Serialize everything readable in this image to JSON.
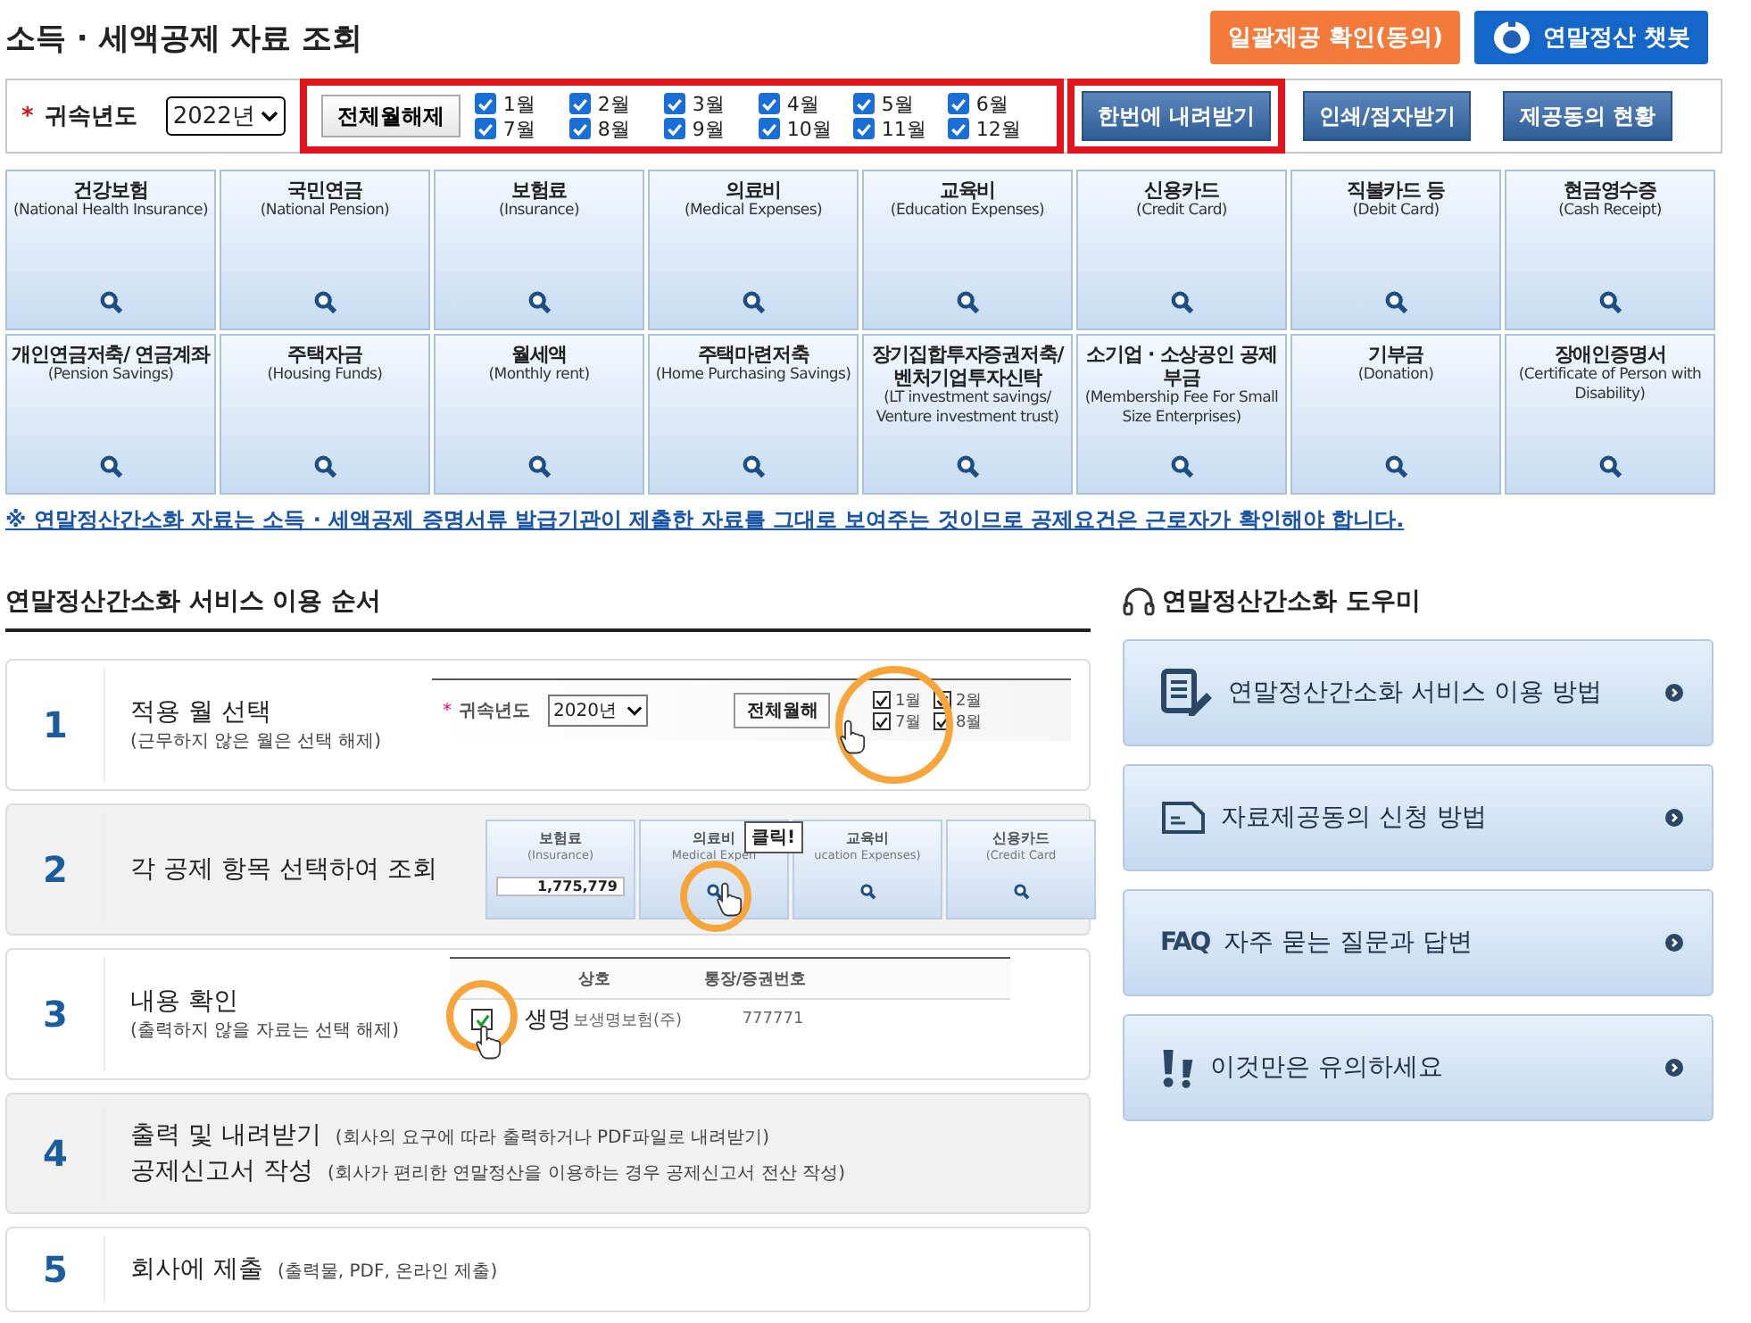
{
  "page_title": "소득 · 세액공제 자료 조회",
  "header_buttons": [
    {
      "kind": "consent",
      "label": "일괄제공 확인(동의)"
    },
    {
      "kind": "chatbot",
      "label": "연말정산 챗봇"
    }
  ],
  "filter": {
    "required_mark": "*",
    "year_label": "귀속년도",
    "year": "2022년",
    "highlighted": true,
    "clear_button": "전체월해제",
    "months": [
      {
        "label": "1월",
        "checked": true
      },
      {
        "label": "2월",
        "checked": true
      },
      {
        "label": "3월",
        "checked": true
      },
      {
        "label": "4월",
        "checked": true
      },
      {
        "label": "5월",
        "checked": true
      },
      {
        "label": "6월",
        "checked": true
      },
      {
        "label": "7월",
        "checked": true
      },
      {
        "label": "8월",
        "checked": true
      },
      {
        "label": "9월",
        "checked": true
      },
      {
        "label": "10월",
        "checked": true
      },
      {
        "label": "11월",
        "checked": true
      },
      {
        "label": "12월",
        "checked": true
      }
    ],
    "buttons": [
      {
        "label": "한번에 내려받기",
        "highlighted": true
      },
      {
        "label": "인쇄/점자받기",
        "highlighted": false
      },
      {
        "label": "제공동의 현황",
        "highlighted": false
      }
    ]
  },
  "categories": [
    {
      "title": "건강보험",
      "subtitle": "(National Health Insurance)"
    },
    {
      "title": "국민연금",
      "subtitle": "(National Pension)"
    },
    {
      "title": "보험료",
      "subtitle": "(Insurance)"
    },
    {
      "title": "의료비",
      "subtitle": "(Medical Expenses)"
    },
    {
      "title": "교육비",
      "subtitle": "(Education Expenses)"
    },
    {
      "title": "신용카드",
      "subtitle": "(Credit Card)"
    },
    {
      "title": "직불카드 등",
      "subtitle": "(Debit Card)"
    },
    {
      "title": "현금영수증",
      "subtitle": "(Cash Receipt)"
    },
    {
      "title": "개인연금저축/ 연금계좌",
      "subtitle": "(Pension Savings)"
    },
    {
      "title": "주택자금",
      "subtitle": "(Housing Funds)"
    },
    {
      "title": "월세액",
      "subtitle": "(Monthly rent)"
    },
    {
      "title": "주택마련저축",
      "subtitle": "(Home Purchasing Savings)"
    },
    {
      "title": "장기집합투자증권저축/ 벤처기업투자신탁",
      "subtitle": "(LT investment savings/ Venture investment trust)"
    },
    {
      "title": "소기업 · 소상공인 공제부금",
      "subtitle": "(Membership Fee For Small Size Enterprises)"
    },
    {
      "title": "기부금",
      "subtitle": "(Donation)"
    },
    {
      "title": "장애인증명서",
      "subtitle": "(Certificate of Person with Disability)"
    }
  ],
  "notice": "※ 연말정산간소화 자료는 소득 · 세액공제 증명서류 발급기관이 제출한 자료를 그대로 보여주는 것이므로 공제요건은 근로자가 확인해야 합니다.",
  "steps_section": {
    "title": "연말정산간소화 서비스 이용 순서",
    "steps": [
      {
        "number": "1",
        "kind": "stacked",
        "shaded": false,
        "lines": [
          {
            "title": "적용 월 선택",
            "note": "(근무하지 않은 월은 선택 해제)"
          }
        ],
        "illustration": {
          "kind": "months",
          "required_mark": "*",
          "year_label": "귀속년도",
          "year": "2020년",
          "button": "전체월해",
          "months": [
            {
              "label": "1월",
              "checked": true
            },
            {
              "label": "7월",
              "checked": true
            },
            {
              "label": "2월",
              "checked": true
            },
            {
              "label": "8월",
              "checked": true
            }
          ]
        }
      },
      {
        "number": "2",
        "kind": "stacked",
        "shaded": true,
        "lines": [
          {
            "title": "각 공제 항목 선택하여 조회"
          }
        ],
        "illustration": {
          "kind": "tiles",
          "callout": "클릭!",
          "tiles": [
            {
              "title": "보험료",
              "subtitle": "(Insurance)",
              "amount": "1,775,779",
              "highlighted": false
            },
            {
              "title": "의료비",
              "subtitle": "Medical Expen",
              "highlighted": true
            },
            {
              "title": "교육비",
              "subtitle": "ucation Expenses)",
              "highlighted": false
            },
            {
              "title": "신용카드",
              "subtitle": "(Credit Card",
              "highlighted": false
            }
          ]
        }
      },
      {
        "number": "3",
        "kind": "stacked",
        "shaded": false,
        "lines": [
          {
            "title": "내용 확인",
            "note": "(출력하지 않을 자료는 선택 해제)"
          }
        ],
        "illustration": {
          "kind": "table",
          "columns": [
            "상호",
            "통장/증권번호"
          ],
          "rows": [
            {
              "checked": true,
              "mark": "생명",
              "name": "보생명보험(주)",
              "account": "777771"
            }
          ]
        }
      },
      {
        "number": "4",
        "kind": "inline",
        "shaded": true,
        "lines": [
          {
            "title": "출력 및 내려받기",
            "note": "(회사의 요구에 따라 출력하거나 PDF파일로 내려받기)"
          },
          {
            "title": "공제신고서 작성",
            "note": "(회사가 편리한 연말정산을 이용하는 경우 공제신고서 전산 작성)"
          }
        ]
      },
      {
        "number": "5",
        "kind": "inline",
        "shaded": false,
        "lines": [
          {
            "title": "회사에 제출",
            "note": "(출력물, PDF, 온라인 제출)"
          }
        ]
      }
    ]
  },
  "helper_section": {
    "title": "연말정산간소화 도우미",
    "items": [
      {
        "kind": "guide",
        "label": "연말정산간소화 서비스 이용 방법"
      },
      {
        "kind": "form",
        "label": "자료제공동의 신청 방법"
      },
      {
        "kind": "faq",
        "badge": "FAQ",
        "label": "자주 묻는 질문과 답변"
      },
      {
        "kind": "caution",
        "label": "이것만은 유의하세요"
      }
    ]
  }
}
